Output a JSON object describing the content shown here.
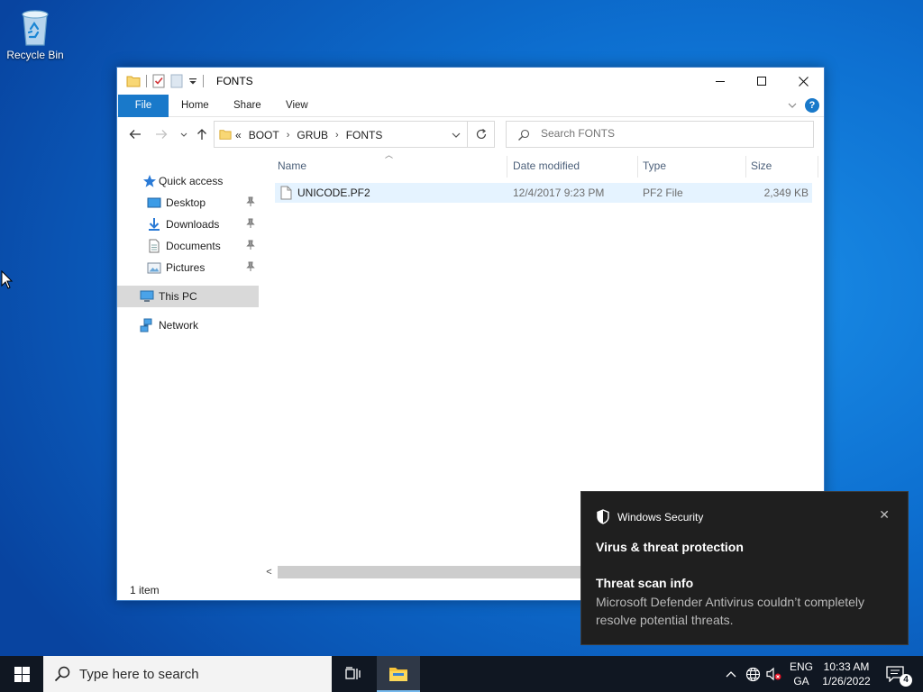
{
  "desktop": {
    "recycle_bin_label": "Recycle Bin"
  },
  "explorer": {
    "title": "FONTS",
    "ribbon_tabs": [
      "File",
      "Home",
      "Share",
      "View"
    ],
    "address": {
      "overflow": "«",
      "crumbs": [
        "BOOT",
        "GRUB",
        "FONTS"
      ]
    },
    "search_placeholder": "Search FONTS",
    "nav": {
      "quick_access": "Quick access",
      "desktop": "Desktop",
      "downloads": "Downloads",
      "documents": "Documents",
      "pictures": "Pictures",
      "this_pc": "This PC",
      "network": "Network"
    },
    "columns": {
      "name": "Name",
      "date_modified": "Date modified",
      "type": "Type",
      "size": "Size"
    },
    "files": [
      {
        "name": "UNICODE.PF2",
        "date_modified": "12/4/2017 9:23 PM",
        "type": "PF2 File",
        "size": "2,349 KB"
      }
    ],
    "status": "1 item"
  },
  "toast": {
    "app": "Windows Security",
    "title": "Virus & threat protection",
    "subtitle": "Threat scan info",
    "body": "Microsoft Defender Antivirus couldn’t completely resolve potential threats."
  },
  "taskbar": {
    "search_placeholder": "Type here to search",
    "lang_line1": "ENG",
    "lang_line2": "GA",
    "time": "10:33 AM",
    "date": "1/26/2022",
    "notification_count": "4"
  },
  "colors": {
    "accent": "#1979ca",
    "selection": "#e5f3ff",
    "taskbar": "#101722",
    "toast_bg": "#1f1f1f"
  }
}
